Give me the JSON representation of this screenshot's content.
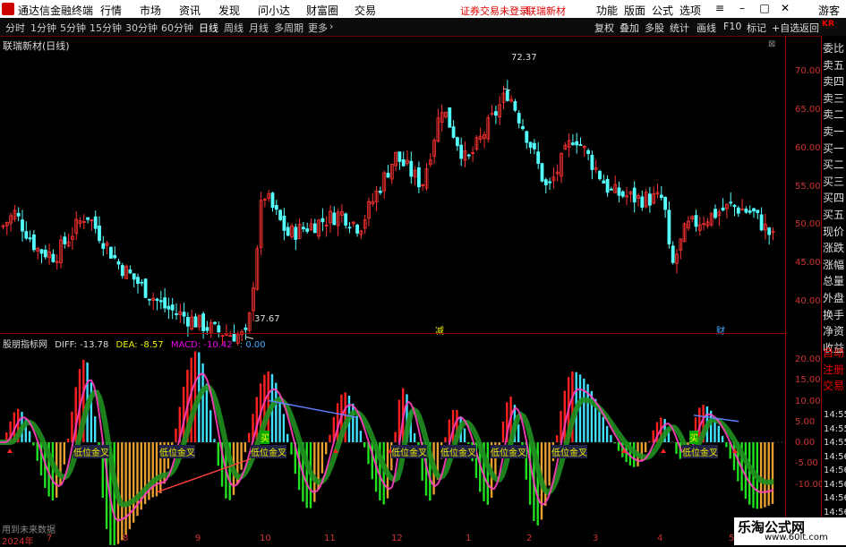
{
  "titlebar": {
    "app_name": "通达信金融终端",
    "menus": [
      "行情",
      "市场",
      "资讯",
      "发现",
      "问小达",
      "财富圈",
      "交易"
    ],
    "status": "证券交易未登录",
    "stock": "联瑞新材",
    "right_menus": [
      "功能",
      "版面",
      "公式",
      "选项"
    ],
    "user": "游客"
  },
  "toolbar": {
    "periods": [
      "分时",
      "1分钟",
      "5分钟",
      "15分钟",
      "30分钟",
      "60分钟",
      "日线",
      "周线",
      "月线",
      "多周期",
      "更多"
    ],
    "active_period": "日线",
    "right_items": [
      "复权",
      "叠加",
      "多股",
      "统计",
      "画线",
      "F10",
      "标记",
      "+自选",
      "返回"
    ]
  },
  "chart": {
    "title": "联瑞新材(日线)",
    "price_axis": [
      "70.00",
      "65.00",
      "60.00",
      "55.00",
      "50.00",
      "45.00",
      "40.00"
    ],
    "high_label": "72.37",
    "low_label": "37.67",
    "marker_jian": "减",
    "marker_cai": "财"
  },
  "indicator": {
    "name": "股朋指标网",
    "diff": "DIFF: -13.78",
    "dea": "DEA: -8.57",
    "macd": "MACD: -10.42",
    "extra": ": 0.00",
    "axis": [
      "20.00",
      "15.00",
      "10.00",
      "5.00",
      "0.00",
      "-5.00",
      "-10.00"
    ],
    "labels": [
      "低位金叉",
      "低位金叉",
      "低位金叉",
      "低位金叉",
      "低位金叉",
      "低位金叉",
      "低位金叉",
      "低位金叉"
    ],
    "buy_labels": [
      "买",
      "买"
    ]
  },
  "dates": {
    "year": "2024年",
    "months": [
      "7",
      "8",
      "9",
      "10",
      "11",
      "12",
      "1",
      "2",
      "3",
      "4",
      "5"
    ]
  },
  "footnote": "用到未来数据",
  "right_panel": {
    "top": "KR",
    "items": [
      "委比",
      "卖五",
      "卖四",
      "卖三",
      "卖二",
      "卖一",
      "买一",
      "买二",
      "买三",
      "买四",
      "买五",
      "现价",
      "涨跌",
      "涨幅",
      "总量",
      "外盘",
      "换手",
      "净资",
      "收益",
      "自动",
      "注册",
      "交易"
    ],
    "times": [
      "14:55",
      "14:55",
      "14:55",
      "14:56",
      "14:56",
      "14:56",
      "14:56",
      "14:56"
    ]
  },
  "watermark": {
    "line1": "乐淘公式网",
    "line2": "www.60lt.com"
  }
}
